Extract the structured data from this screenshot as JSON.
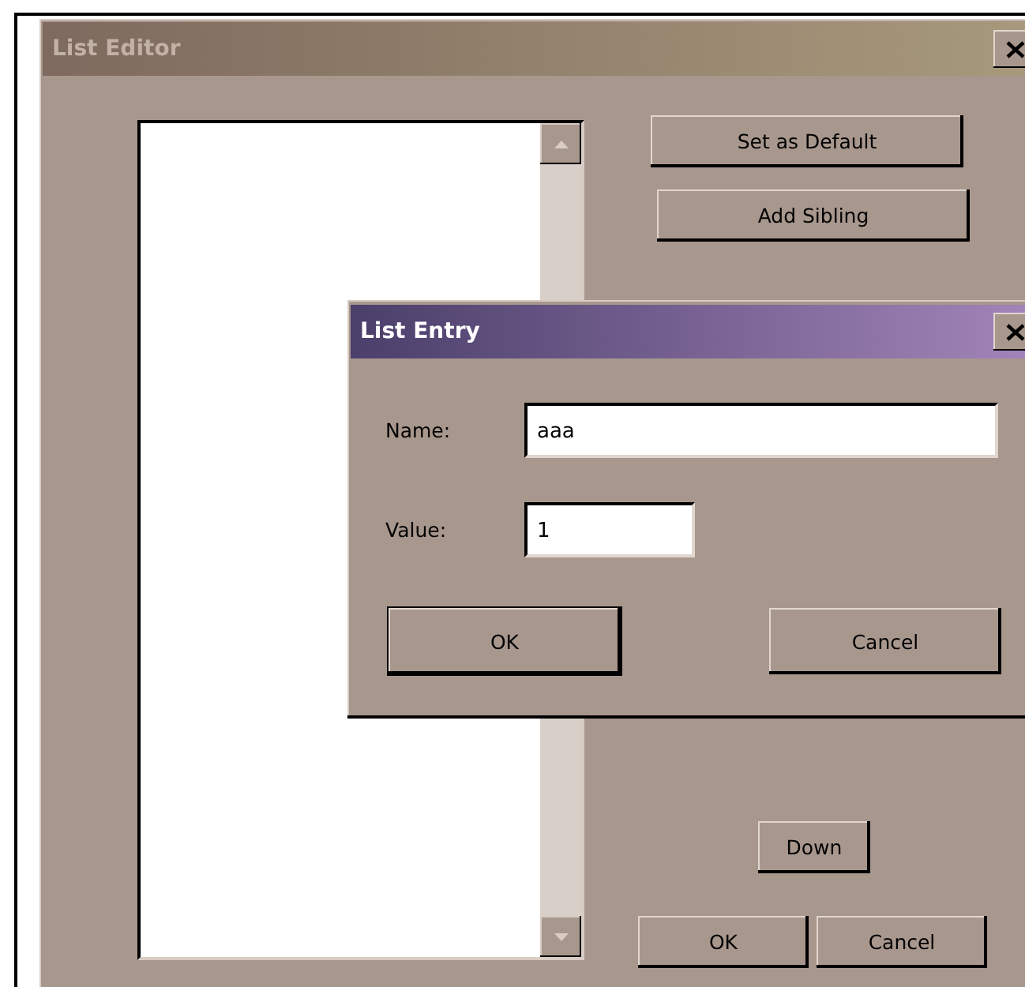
{
  "main_window": {
    "title": "List Editor",
    "active": false,
    "side_buttons": [
      {
        "label": "Set as Default"
      },
      {
        "label": "Add Sibling"
      }
    ],
    "move_button": {
      "label": "Down"
    },
    "buttons": [
      {
        "label": "OK"
      },
      {
        "label": "Cancel"
      }
    ]
  },
  "dialog": {
    "title": "List Entry",
    "active": true,
    "fields": [
      {
        "label": "Name:",
        "value": "aaa"
      },
      {
        "label": "Value:",
        "value": "1"
      }
    ],
    "buttons": [
      {
        "label": "OK",
        "default": true
      },
      {
        "label": "Cancel",
        "default": false
      }
    ]
  }
}
